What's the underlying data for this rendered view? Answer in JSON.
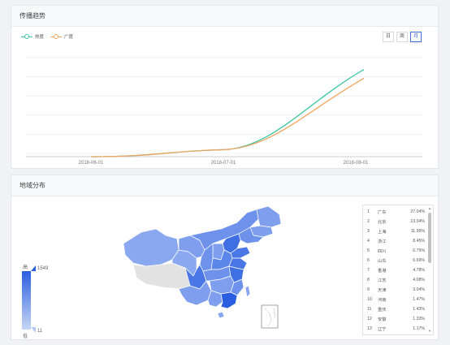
{
  "trend": {
    "title": "传播趋势",
    "legend": [
      {
        "name": "热度",
        "color": "#3cc6a2"
      },
      {
        "name": "广度",
        "color": "#f0a35d"
      }
    ],
    "range_tabs": [
      {
        "label": "日",
        "active": false
      },
      {
        "label": "周",
        "active": false
      },
      {
        "label": "月",
        "active": true
      }
    ]
  },
  "chart_data": {
    "type": "line",
    "x": [
      "2018-06-01",
      "2018-07-01",
      "2018-08-01"
    ],
    "xlabel": "",
    "ylabel": "",
    "grid": true,
    "legend_position": "top-left",
    "series": [
      {
        "name": "热度",
        "color": "#3cc6a2",
        "values": [
          0,
          8,
          100
        ]
      },
      {
        "name": "广度",
        "color": "#f0a35d",
        "values": [
          0,
          8,
          90
        ]
      }
    ],
    "ylim": [
      0,
      110
    ]
  },
  "region": {
    "title": "地域分布",
    "scale": {
      "high_label": "高",
      "low_label": "低",
      "max": "1549",
      "min": "11"
    },
    "ranking": [
      {
        "no": "1",
        "name": "广东",
        "pct": "27.04%"
      },
      {
        "no": "2",
        "name": "北京",
        "pct": "13.04%"
      },
      {
        "no": "3",
        "name": "上海",
        "pct": "11.99%"
      },
      {
        "no": "4",
        "name": "浙江",
        "pct": "8.45%"
      },
      {
        "no": "5",
        "name": "四川",
        "pct": "6.79%"
      },
      {
        "no": "6",
        "name": "山东",
        "pct": "6.69%"
      },
      {
        "no": "7",
        "name": "香港",
        "pct": "4.78%"
      },
      {
        "no": "8",
        "name": "江苏",
        "pct": "4.08%"
      },
      {
        "no": "9",
        "name": "天津",
        "pct": "3.04%"
      },
      {
        "no": "10",
        "name": "河南",
        "pct": "1.47%"
      },
      {
        "no": "11",
        "name": "重庆",
        "pct": "1.43%"
      },
      {
        "no": "12",
        "name": "安徽",
        "pct": "1.33%"
      },
      {
        "no": "13",
        "name": "辽宁",
        "pct": "1.17%"
      }
    ],
    "map_colors": {
      "dark": "#2a5de0",
      "mid": "#5b86ea",
      "light": "#8aa8ef",
      "none": "#e2e2e2"
    }
  }
}
